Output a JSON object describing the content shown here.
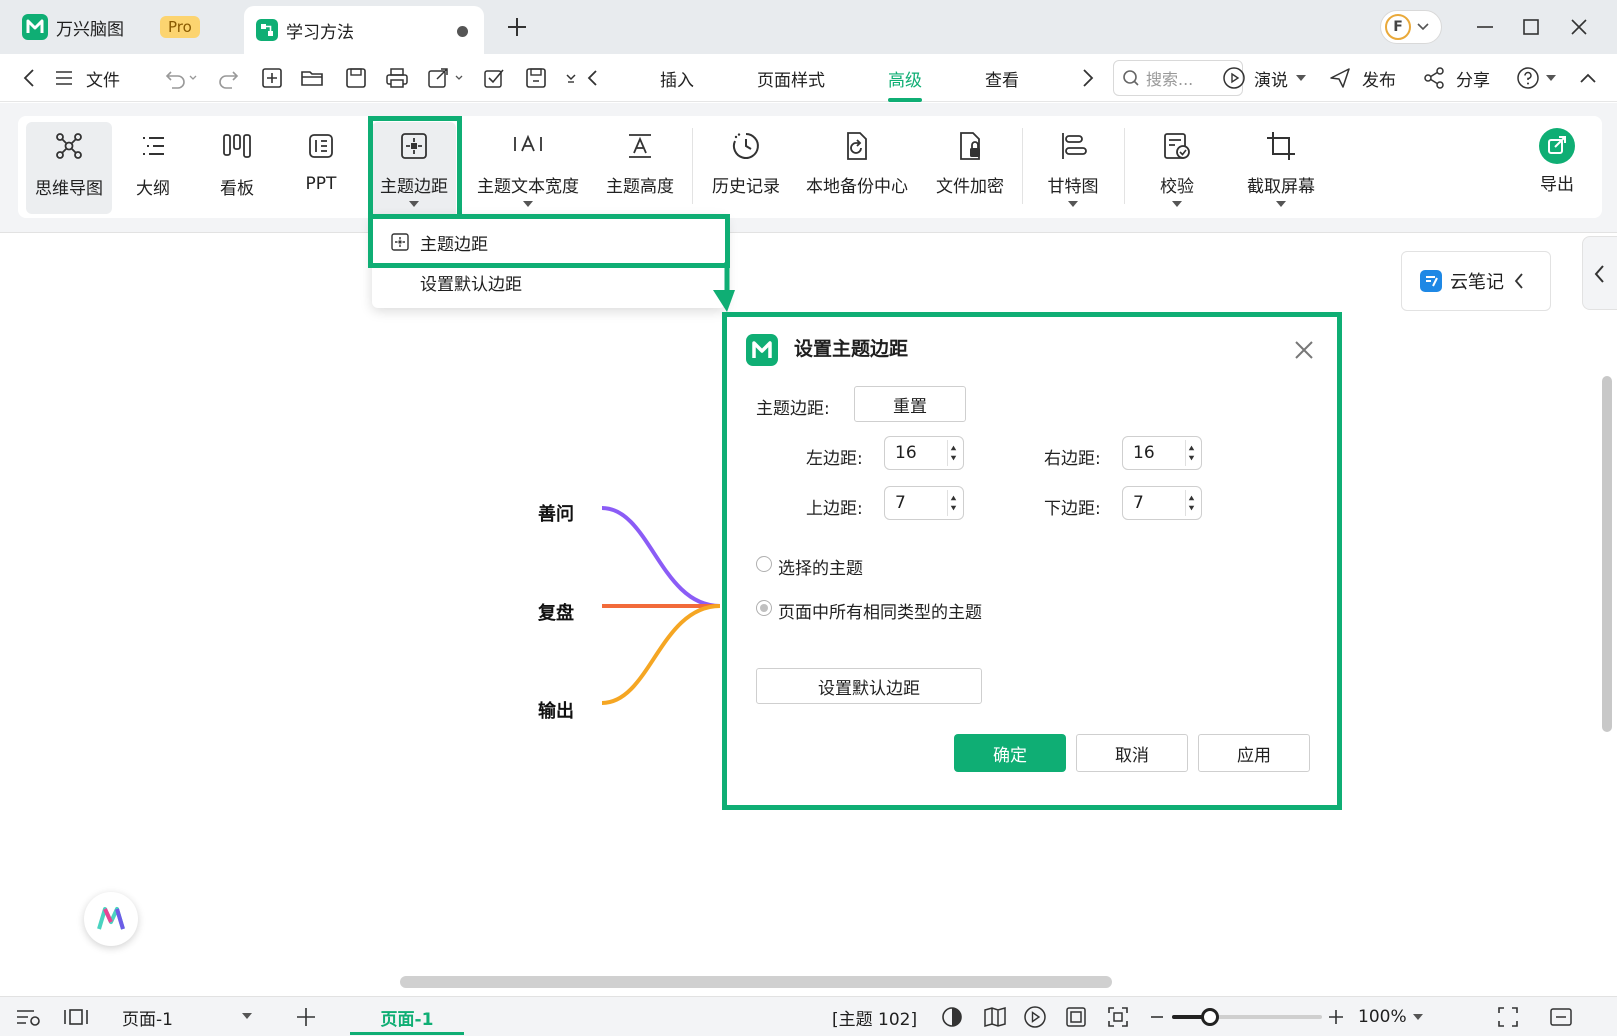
{
  "app": {
    "name": "万兴脑图",
    "badge": "Pro",
    "document_tab": "学习方法",
    "avatar_letter": "F"
  },
  "menu": {
    "file_label": "文件",
    "tabs": [
      "插入",
      "页面样式",
      "高级",
      "查看"
    ],
    "active_tab": "高级",
    "search_placeholder": "搜索...",
    "present_label": "演说",
    "publish_label": "发布",
    "share_label": "分享"
  },
  "toolbar": {
    "view_modes": [
      {
        "label": "思维导图",
        "icon": "mindmap-icon",
        "selected": true
      },
      {
        "label": "大纲",
        "icon": "outline-icon"
      },
      {
        "label": "看板",
        "icon": "kanban-icon"
      },
      {
        "label": "PPT",
        "icon": "ppt-icon"
      }
    ],
    "tools": [
      {
        "label": "主题边距",
        "icon": "topic-margin-icon",
        "dropdown": true
      },
      {
        "label": "主题文本宽度",
        "icon": "text-width-icon",
        "dropdown": true
      },
      {
        "label": "主题高度",
        "icon": "topic-height-icon"
      },
      {
        "label": "历史记录",
        "icon": "history-icon"
      },
      {
        "label": "本地备份中心",
        "icon": "backup-icon"
      },
      {
        "label": "文件加密",
        "icon": "encrypt-icon"
      },
      {
        "label": "甘特图",
        "icon": "gantt-icon",
        "dropdown": true
      },
      {
        "label": "校验",
        "icon": "verify-icon",
        "dropdown": true
      },
      {
        "label": "截取屏幕",
        "icon": "crop-icon",
        "dropdown": true
      }
    ],
    "export_label": "导出"
  },
  "dropdown": {
    "items": [
      "主题边距",
      "设置默认边距"
    ]
  },
  "mindmap": {
    "branches": [
      {
        "label": "善问",
        "color": "#8b5cf6"
      },
      {
        "label": "复盘",
        "color": "#f26b3a"
      },
      {
        "label": "输出",
        "color": "#f5a623"
      }
    ]
  },
  "cloud_note": {
    "label": "云笔记"
  },
  "dialog": {
    "title": "设置主题边距",
    "margin_label": "主题边距:",
    "reset_label": "重置",
    "left_label": "左边距:",
    "left_value": "16",
    "right_label": "右边距:",
    "right_value": "16",
    "top_label": "上边距:",
    "top_value": "7",
    "bottom_label": "下边距:",
    "bottom_value": "7",
    "radio_selected_topic": "选择的主题",
    "radio_all_same": "页面中所有相同类型的主题",
    "set_default_label": "设置默认边距",
    "ok_label": "确定",
    "cancel_label": "取消",
    "apply_label": "应用"
  },
  "statusbar": {
    "page_select": "页面-1",
    "page_tab": "页面-1",
    "topic_count": "[主题 102]",
    "zoom": "100%",
    "zoom_fraction": 0.25
  },
  "colors": {
    "accent": "#0fae74",
    "highlight": "#0fae74"
  }
}
